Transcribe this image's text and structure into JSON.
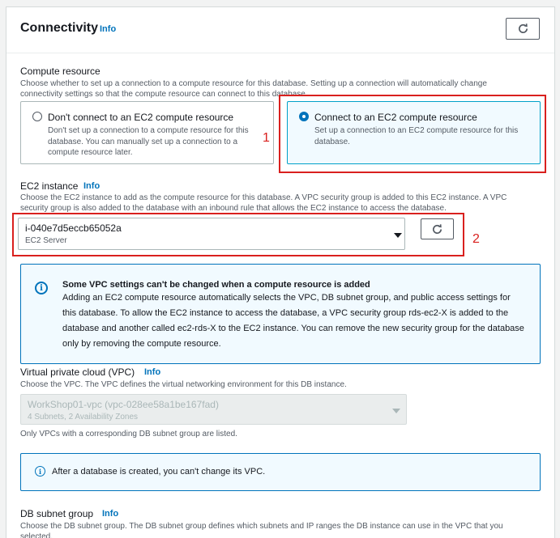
{
  "panel": {
    "title": "Connectivity",
    "info": "Info"
  },
  "compute": {
    "label": "Compute resource",
    "description": "Choose whether to set up a connection to a compute resource for this database. Setting up a connection will automatically change connectivity settings so that the compute resource can connect to this database.",
    "options": [
      {
        "title": "Don't connect to an EC2 compute resource",
        "description": "Don't set up a connection to a compute resource for this database. You can manually set up a connection to a compute resource later.",
        "selected": false
      },
      {
        "title": "Connect to an EC2 compute resource",
        "description": "Set up a connection to an EC2 compute resource for this database.",
        "selected": true
      }
    ]
  },
  "annotations": [
    "1",
    "2"
  ],
  "ec2": {
    "label": "EC2 instance",
    "info": "Info",
    "description": "Choose the EC2 instance to add as the compute resource for this database. A VPC security group is added to this EC2 instance. A VPC security group is also added to the database with an inbound rule that allows the EC2 instance to access the database.",
    "selected_value": "i-040e7d5eccb65052a",
    "selected_sub": "EC2 Server"
  },
  "vpc_alert": {
    "title": "Some VPC settings can't be changed when a compute resource is added",
    "body": "Adding an EC2 compute resource automatically selects the VPC, DB subnet group, and public access settings for this database. To allow the EC2 instance to access the database, a VPC security group rds-ec2-X is added to the database and another called ec2-rds-X to the EC2 instance. You can remove the new security group for the database only by removing the compute resource."
  },
  "vpc": {
    "label": "Virtual private cloud (VPC)",
    "info": "Info",
    "description": "Choose the VPC. The VPC defines the virtual networking environment for this DB instance.",
    "selected_value": "WorkShop01-vpc (vpc-028ee58a1be167fad)",
    "selected_sub": "4 Subnets, 2 Availability Zones",
    "hint": "Only VPCs with a corresponding DB subnet group are listed.",
    "alert": "After a database is created, you can't change its VPC."
  },
  "subnet": {
    "label": "DB subnet group",
    "info": "Info",
    "description": "Choose the DB subnet group. The DB subnet group defines which subnets and IP ranges the DB instance can use in the VPC that you selected."
  },
  "colors": {
    "accent": "#0073bb",
    "annotation_red": "#d9201e",
    "selected_tile_bg": "#f1faff"
  }
}
